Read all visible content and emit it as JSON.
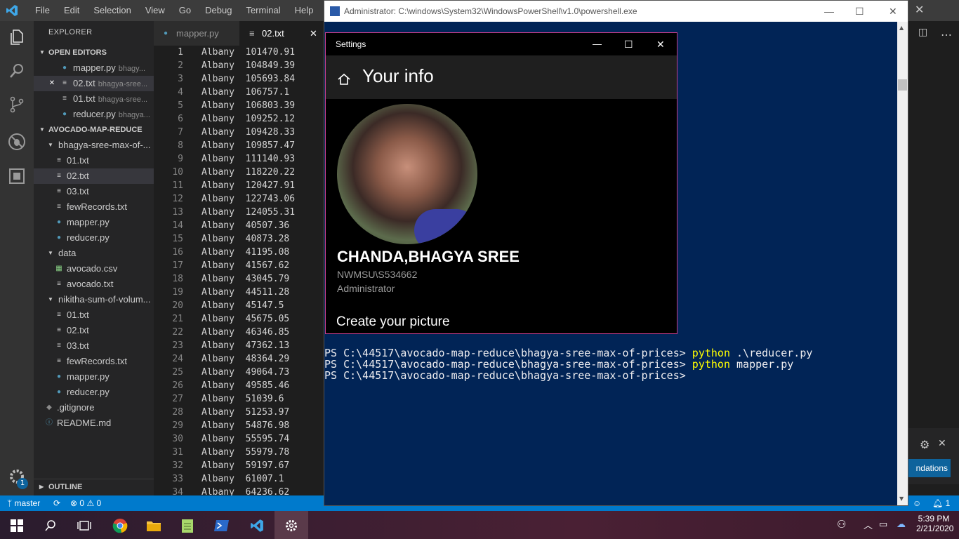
{
  "vscode": {
    "menu": [
      "File",
      "Edit",
      "Selection",
      "View",
      "Go",
      "Debug",
      "Terminal",
      "Help"
    ],
    "explorer_title": "EXPLORER",
    "open_editors_title": "OPEN EDITORS",
    "open_editors": [
      {
        "name": "mapper.py",
        "desc": "bhagy...",
        "kind": "py"
      },
      {
        "name": "02.txt",
        "desc": "bhagya-sree...",
        "kind": "txt"
      },
      {
        "name": "01.txt",
        "desc": "bhagya-sree...",
        "kind": "txt"
      },
      {
        "name": "reducer.py",
        "desc": "bhagya...",
        "kind": "py"
      }
    ],
    "project_title": "AVOCADO-MAP-REDUCE",
    "tree": [
      {
        "name": "bhagya-sree-max-of-...",
        "kind": "folder"
      },
      {
        "name": "01.txt",
        "kind": "txt"
      },
      {
        "name": "02.txt",
        "kind": "txt"
      },
      {
        "name": "03.txt",
        "kind": "txt"
      },
      {
        "name": "fewRecords.txt",
        "kind": "txt"
      },
      {
        "name": "mapper.py",
        "kind": "py"
      },
      {
        "name": "reducer.py",
        "kind": "py"
      },
      {
        "name": "data",
        "kind": "folder"
      },
      {
        "name": "avocado.csv",
        "kind": "csv"
      },
      {
        "name": "avocado.txt",
        "kind": "txt"
      },
      {
        "name": "nikitha-sum-of-volum...",
        "kind": "folder"
      },
      {
        "name": "01.txt",
        "kind": "txt"
      },
      {
        "name": "02.txt",
        "kind": "txt"
      },
      {
        "name": "03.txt",
        "kind": "txt"
      },
      {
        "name": "fewRecords.txt",
        "kind": "txt"
      },
      {
        "name": "mapper.py",
        "kind": "py"
      },
      {
        "name": "reducer.py",
        "kind": "py"
      },
      {
        "name": ".gitignore",
        "kind": "git"
      },
      {
        "name": "README.md",
        "kind": "info"
      }
    ],
    "outline_title": "OUTLINE",
    "tabs": [
      {
        "label": "mapper.py"
      },
      {
        "label": "02.txt"
      }
    ],
    "settings_badge": "1",
    "editor_lines": [
      "Albany  101470.91",
      "Albany  104849.39",
      "Albany  105693.84",
      "Albany  106757.1",
      "Albany  106803.39",
      "Albany  109252.12",
      "Albany  109428.33",
      "Albany  109857.47",
      "Albany  111140.93",
      "Albany  118220.22",
      "Albany  120427.91",
      "Albany  122743.06",
      "Albany  124055.31",
      "Albany  40507.36",
      "Albany  40873.28",
      "Albany  41195.08",
      "Albany  41567.62",
      "Albany  43045.79",
      "Albany  44511.28",
      "Albany  45147.5",
      "Albany  45675.05",
      "Albany  46346.85",
      "Albany  47362.13",
      "Albany  48364.29",
      "Albany  49064.73",
      "Albany  49585.46",
      "Albany  51039.6",
      "Albany  51253.97",
      "Albany  54876.98",
      "Albany  55595.74",
      "Albany  55979.78",
      "Albany  59197.67",
      "Albany  61007.1",
      "Albany  64236.62"
    ],
    "status": {
      "branch": "master",
      "errors": "0",
      "warnings": "0",
      "bell": "1"
    },
    "notification_button": "ndations"
  },
  "powershell": {
    "title": "Administrator: C:\\windows\\System32\\WindowsPowerShell\\v1.0\\powershell.exe",
    "lines": [
      {
        "prompt": "PS C:\\44517\\avocado-map-reduce\\bhagya-sree-max-of-prices> ",
        "cmd": "python",
        "rest": " .\\reducer.py"
      },
      {
        "prompt": "PS C:\\44517\\avocado-map-reduce\\bhagya-sree-max-of-prices> ",
        "cmd": "python",
        "rest": " mapper.py"
      },
      {
        "prompt": "PS C:\\44517\\avocado-map-reduce\\bhagya-sree-max-of-prices>",
        "cmd": "",
        "rest": ""
      }
    ]
  },
  "settings": {
    "window_title": "Settings",
    "page_title": "Your info",
    "user_name": "CHANDA,BHAGYA SREE",
    "account": "NWMSU\\S534662",
    "role": "Administrator",
    "create_picture": "Create your picture"
  },
  "taskbar": {
    "time": "5:39 PM",
    "date": "2/21/2020"
  },
  "colors": {
    "statusbar": "#007acc",
    "powershell_bg": "#012456",
    "settings_border": "#c73e8d"
  }
}
